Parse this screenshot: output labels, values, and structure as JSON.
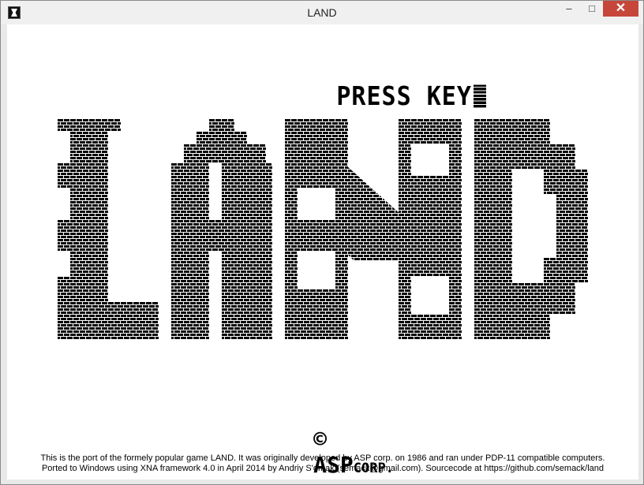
{
  "window": {
    "title": "LAND",
    "icon": "app-icon",
    "controls": {
      "minimize": "–",
      "maximize": "□",
      "close": "✕"
    }
  },
  "game": {
    "press_key": "PRESS KEY",
    "logo_text": "LAND",
    "copyright_symbol": "©",
    "company": "ASP",
    "company_suffix": "CORP.",
    "footer_line1": "This is the port of the formely popular game LAND. It was originally developed by ASP corp. on 1986 and ran under PDP-11 compatible computers.",
    "footer_line2": "Ported to Windows using XNA framework 4.0 in April 2014 by Andriy S'omak (semack@gmail.com). Sourcecode at https://github.com/semack/land"
  }
}
